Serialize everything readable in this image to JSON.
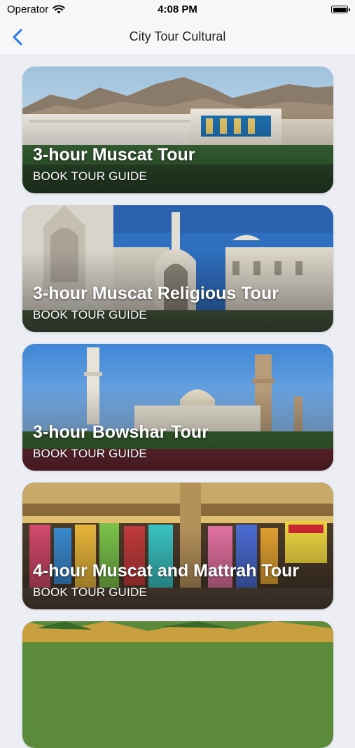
{
  "status_bar": {
    "carrier": "Operator",
    "time": "4:08 PM"
  },
  "nav": {
    "title": "City Tour Cultural"
  },
  "tours": [
    {
      "title": "3-hour Muscat Tour",
      "subtitle": "BOOK TOUR GUIDE"
    },
    {
      "title": "3-hour Muscat Religious Tour",
      "subtitle": "BOOK TOUR GUIDE"
    },
    {
      "title": "3-hour Bowshar Tour",
      "subtitle": "BOOK TOUR GUIDE"
    },
    {
      "title": "4-hour Muscat and Mattrah Tour",
      "subtitle": "BOOK TOUR GUIDE"
    }
  ],
  "colors": {
    "accent": "#1f78f0",
    "background": "#eceef3",
    "nav_background": "#f7f7f9"
  }
}
